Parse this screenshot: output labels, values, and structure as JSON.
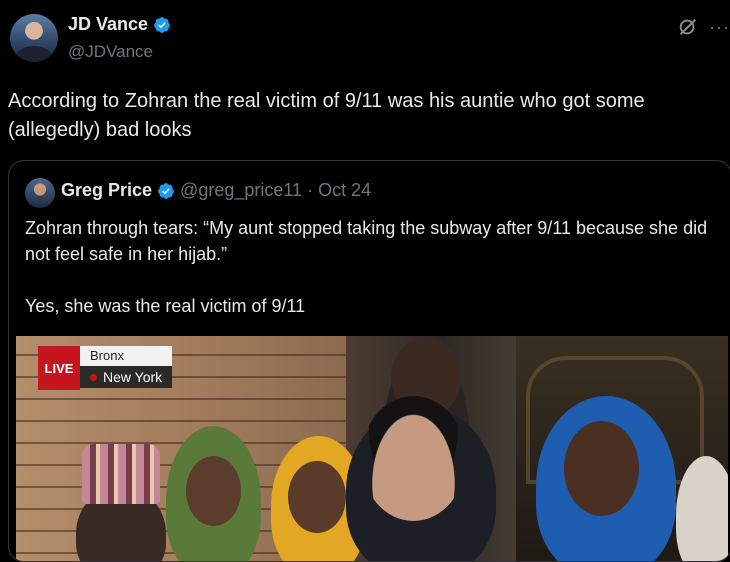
{
  "author": {
    "name": "JD Vance",
    "handle": "@JDVance"
  },
  "tweet": {
    "text": "According to Zohran the real victim of 9/11 was his auntie who got some (allegedly) bad looks"
  },
  "quoted": {
    "name": "Greg Price",
    "handle": "@greg_price11",
    "separator": "·",
    "date": "Oct 24",
    "paragraph1": "Zohran through tears: “My aunt stopped taking the subway after 9/11 because she did not feel safe in her hijab.”",
    "paragraph2": "Yes, she was the real victim of 9/11"
  },
  "video": {
    "live_label": "LIVE",
    "location_top": "Bronx",
    "location_bottom": "New York"
  },
  "colors": {
    "accent": "#1d9bf0",
    "text": "#e7e9ea",
    "muted": "#71767b",
    "live_red": "#c4161c"
  },
  "icons": [
    "verified-badge-icon",
    "grok-icon",
    "more-icon",
    "location-pin-icon"
  ]
}
